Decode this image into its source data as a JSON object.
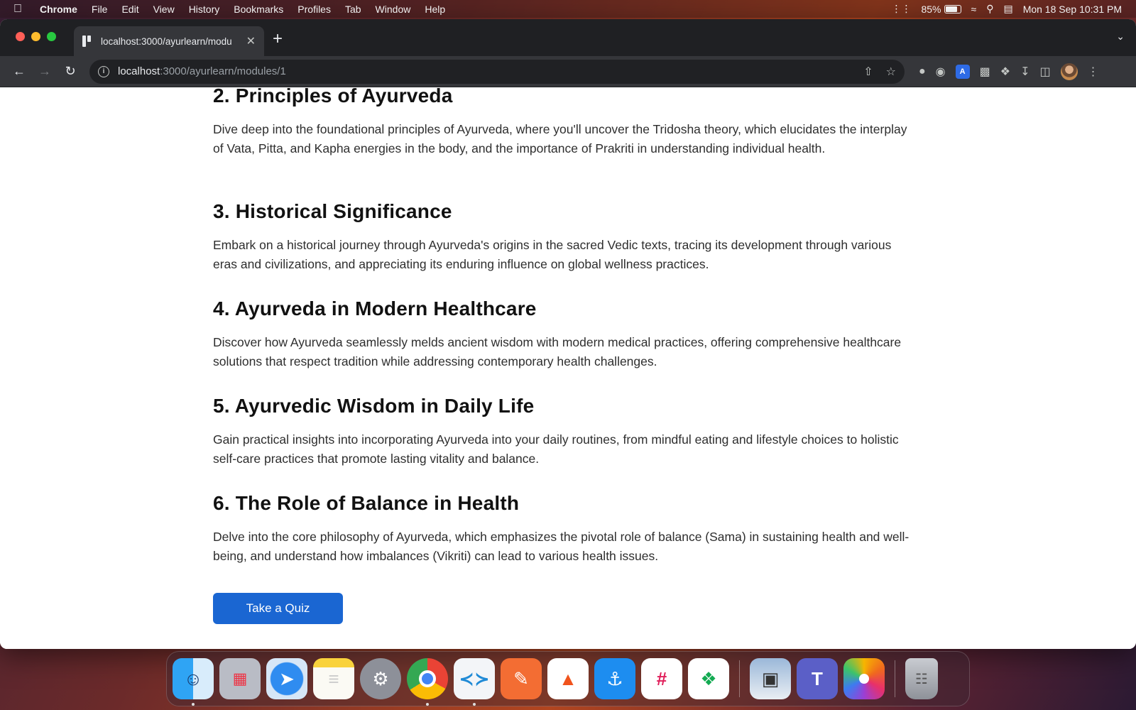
{
  "menubar": {
    "app_name": "Chrome",
    "menus": [
      "File",
      "Edit",
      "View",
      "History",
      "Bookmarks",
      "Profiles",
      "Tab",
      "Window",
      "Help"
    ],
    "battery_percent": "85%",
    "battery_level": 0.85,
    "datetime": "Mon 18 Sep  10:31 PM"
  },
  "browser": {
    "tab_title": "localhost:3000/ayurlearn/modu",
    "url_host": "localhost",
    "url_path": ":3000/ayurlearn/modules/1"
  },
  "content": {
    "sections": [
      {
        "heading": "2. Principles of Ayurveda",
        "body": "Dive deep into the foundational principles of Ayurveda, where you'll uncover the Tridosha theory, which elucidates the interplay of Vata, Pitta, and Kapha energies in the body, and the importance of Prakriti in understanding individual health."
      },
      {
        "heading": "3. Historical Significance",
        "body": "Embark on a historical journey through Ayurveda's origins in the sacred Vedic texts, tracing its development through various eras and civilizations, and appreciating its enduring influence on global wellness practices."
      },
      {
        "heading": "4. Ayurveda in Modern Healthcare",
        "body": "Discover how Ayurveda seamlessly melds ancient wisdom with modern medical practices, offering comprehensive healthcare solutions that respect tradition while addressing contemporary health challenges."
      },
      {
        "heading": "5. Ayurvedic Wisdom in Daily Life",
        "body": "Gain practical insights into incorporating Ayurveda into your daily routines, from mindful eating and lifestyle choices to holistic self-care practices that promote lasting vitality and balance."
      },
      {
        "heading": "6. The Role of Balance in Health",
        "body": "Delve into the core philosophy of Ayurveda, which emphasizes the pivotal role of balance (Sama) in sustaining health and well-being, and understand how imbalances (Vikriti) can lead to various health issues."
      }
    ],
    "quiz_button": "Take a Quiz"
  },
  "colors": {
    "accent": "#1a66d2",
    "chrome_dark": "#35363a"
  },
  "dock": {
    "apps": [
      "finder-icon",
      "launchpad-icon",
      "safari-icon",
      "notes-icon",
      "system-settings-icon",
      "chrome-icon",
      "vscode-icon",
      "postman-icon",
      "brave-icon",
      "docker-icon",
      "slack-icon",
      "mongodb-compass-icon",
      "preview-icon",
      "teams-icon",
      "photos-icon",
      "trash-icon"
    ]
  }
}
